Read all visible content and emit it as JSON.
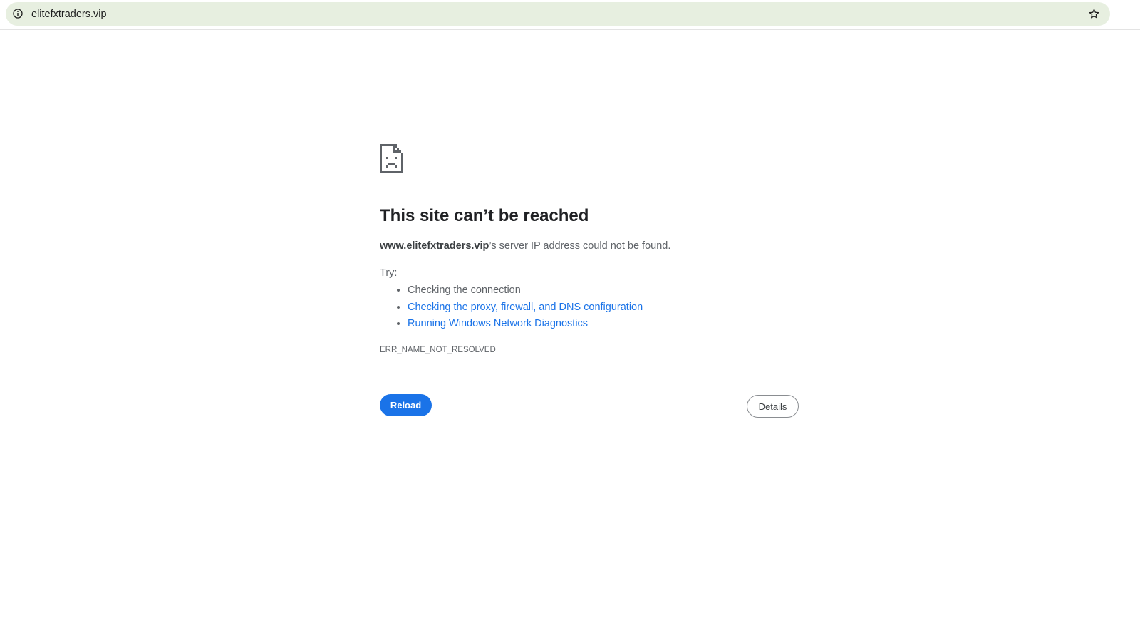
{
  "browser": {
    "url": "elitefxtraders.vip",
    "icons": {
      "site_info": "info-icon",
      "bookmark": "star-icon"
    }
  },
  "error": {
    "icon": "sad-page-icon",
    "title": "This site can’t be reached",
    "host": "www.elitefxtraders.vip",
    "summary_rest": "’s server IP address could not be found.",
    "try_label": "Try:",
    "suggestions": [
      {
        "text": "Checking the connection",
        "link": false
      },
      {
        "text": "Checking the proxy, firewall, and DNS configuration",
        "link": true
      },
      {
        "text": "Running Windows Network Diagnostics",
        "link": true
      }
    ],
    "code": "ERR_NAME_NOT_RESOLVED"
  },
  "buttons": {
    "reload": "Reload",
    "details": "Details"
  },
  "colors": {
    "accent": "#1a73e8",
    "omnibox_bg": "#e7efe0",
    "text_secondary": "#5f6368"
  }
}
